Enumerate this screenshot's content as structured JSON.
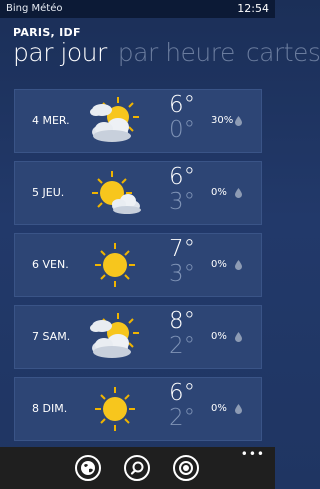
{
  "status_bar": {
    "app_name": "Bing Météo",
    "time": "12:54"
  },
  "location": "PARIS, IDF",
  "pivot": {
    "tabs": [
      "par jour",
      "par heure",
      "cartes"
    ],
    "active": "par jour"
  },
  "days": [
    {
      "label": "4 MER.",
      "icon": "partly-cloudy-icon",
      "high": "6°",
      "low": "0°",
      "precip": "30%"
    },
    {
      "label": "5 JEU.",
      "icon": "sun-behind-cloud-icon",
      "high": "6°",
      "low": "3°",
      "precip": "0%"
    },
    {
      "label": "6 VEN.",
      "icon": "sun-icon",
      "high": "7°",
      "low": "3°",
      "precip": "0%"
    },
    {
      "label": "7 SAM.",
      "icon": "partly-cloudy-icon",
      "high": "8°",
      "low": "2°",
      "precip": "0%"
    },
    {
      "label": "8 DIM.",
      "icon": "sun-icon",
      "high": "6°",
      "low": "2°",
      "precip": "0%"
    }
  ],
  "app_bar": {
    "buttons": [
      "globe-icon",
      "search-icon",
      "locate-icon"
    ],
    "more": "•••"
  },
  "colors": {
    "background": "#1e3663",
    "row": "#2d4575",
    "low_temp": "#7f93b6",
    "sun": "#f7c61d",
    "cloud": "#e9edf2"
  }
}
